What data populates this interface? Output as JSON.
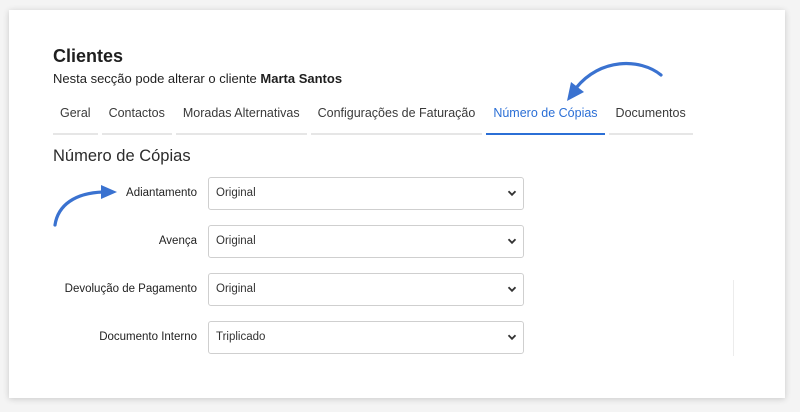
{
  "header": {
    "title": "Clientes",
    "subtitle_prefix": "Nesta secção pode alterar o cliente",
    "client_name": "Marta Santos"
  },
  "tabs": [
    {
      "label": "Geral",
      "active": false
    },
    {
      "label": "Contactos",
      "active": false
    },
    {
      "label": "Moradas Alternativas",
      "active": false
    },
    {
      "label": "Configurações de Faturação",
      "active": false
    },
    {
      "label": "Número de Cópias",
      "active": true
    },
    {
      "label": "Documentos",
      "active": false
    }
  ],
  "section": {
    "title": "Número de Cópias"
  },
  "fields": [
    {
      "label": "Adiantamento",
      "value": "Original"
    },
    {
      "label": "Avença",
      "value": "Original"
    },
    {
      "label": "Devolução de Pagamento",
      "value": "Original"
    },
    {
      "label": "Documento Interno",
      "value": "Triplicado"
    }
  ],
  "colors": {
    "accent": "#2b6fd6",
    "annotation_arrow": "#3a72d0"
  }
}
